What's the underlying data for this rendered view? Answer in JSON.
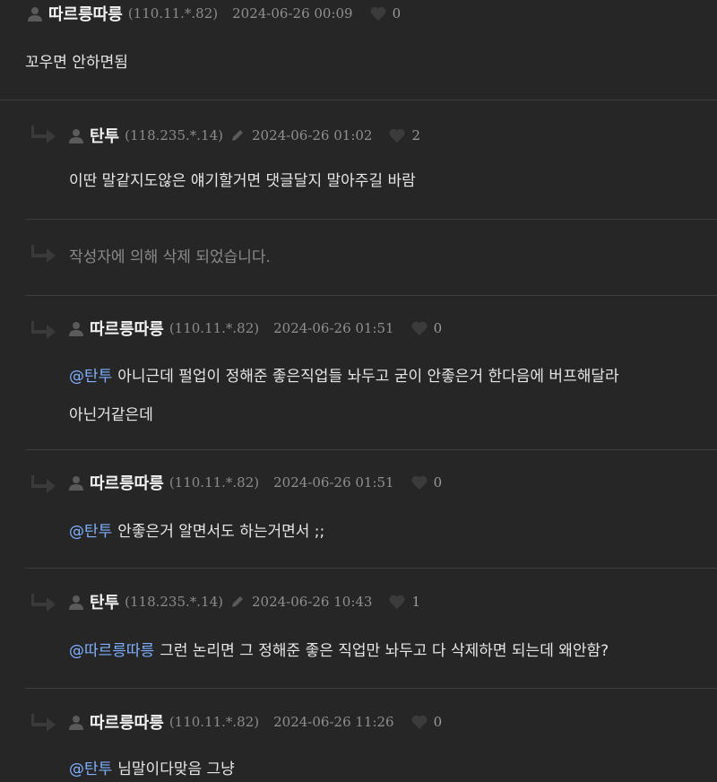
{
  "comments": [
    {
      "nickname": "따르릉따릉",
      "ip": "(110.11.*.82)",
      "date": "2024-06-26 00:09",
      "likes": "0",
      "text": "꼬우면 안하면됨"
    },
    {
      "nickname": "탄투",
      "ip": "(118.235.*.14)",
      "date": "2024-06-26 01:02",
      "likes": "2",
      "text": "이딴 말같지도않은 얘기할거면 댓글달지 말아주길 바람"
    },
    {
      "text": "작성자에 의해 삭제 되었습니다."
    },
    {
      "nickname": "따르릉따릉",
      "ip": "(110.11.*.82)",
      "date": "2024-06-26 01:51",
      "likes": "0",
      "mention": "@탄투",
      "text": "아니근데 펄업이 정해준 좋은직업들 놔두고 굳이 안좋은거 한다음에 버프해달라",
      "text2": "아닌거같은데"
    },
    {
      "nickname": "따르릉따릉",
      "ip": "(110.11.*.82)",
      "date": "2024-06-26 01:51",
      "likes": "0",
      "mention": "@탄투",
      "text": "안좋은거 알면서도 하는거면서 ;;"
    },
    {
      "nickname": "탄투",
      "ip": "(118.235.*.14)",
      "date": "2024-06-26 10:43",
      "likes": "1",
      "mention": "@따르릉따릉",
      "text": "그런 논리면 그 정해준 좋은 직업만 놔두고 다 삭제하면 되는데 왜안함?"
    },
    {
      "nickname": "따르릉따릉",
      "ip": "(110.11.*.82)",
      "date": "2024-06-26 11:26",
      "likes": "0",
      "mention": "@탄투",
      "text": "님말이다맞음 그냥"
    }
  ],
  "colors": {
    "background": "#262626",
    "mention": "#7fb0ff",
    "divider": "#3e3e3e"
  },
  "icons": {
    "author": "person-icon",
    "reply": "reply-arrow-icon",
    "edited": "pencil-icon",
    "like": "heart-icon"
  }
}
